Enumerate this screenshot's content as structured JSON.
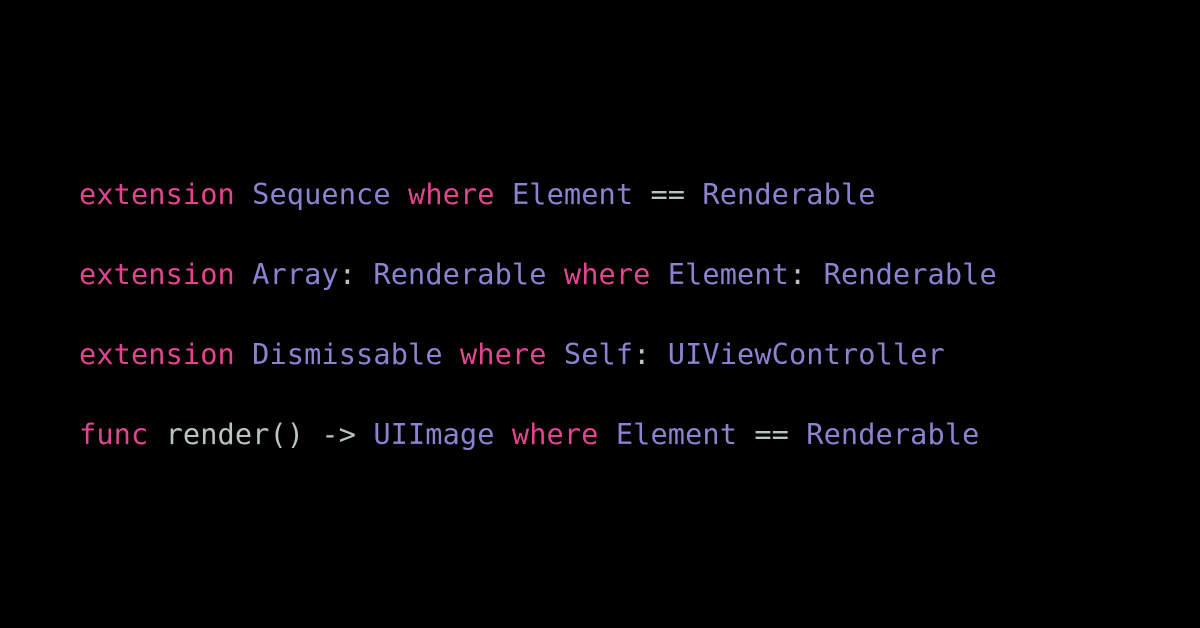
{
  "colors": {
    "background": "#000000",
    "keyword": "#e0458e",
    "type": "#8a83cf",
    "plain": "#b8c4c1"
  },
  "code_lines": [
    {
      "tokens": [
        {
          "text": "extension",
          "kind": "keyword"
        },
        {
          "text": " ",
          "kind": "plain"
        },
        {
          "text": "Sequence",
          "kind": "type"
        },
        {
          "text": " ",
          "kind": "plain"
        },
        {
          "text": "where",
          "kind": "keyword"
        },
        {
          "text": " ",
          "kind": "plain"
        },
        {
          "text": "Element",
          "kind": "type"
        },
        {
          "text": " == ",
          "kind": "punct"
        },
        {
          "text": "Renderable",
          "kind": "type"
        }
      ]
    },
    {
      "tokens": [
        {
          "text": "extension",
          "kind": "keyword"
        },
        {
          "text": " ",
          "kind": "plain"
        },
        {
          "text": "Array",
          "kind": "type"
        },
        {
          "text": ": ",
          "kind": "punct"
        },
        {
          "text": "Renderable",
          "kind": "type"
        },
        {
          "text": " ",
          "kind": "plain"
        },
        {
          "text": "where",
          "kind": "keyword"
        },
        {
          "text": " ",
          "kind": "plain"
        },
        {
          "text": "Element",
          "kind": "type"
        },
        {
          "text": ": ",
          "kind": "punct"
        },
        {
          "text": "Renderable",
          "kind": "type"
        }
      ]
    },
    {
      "tokens": [
        {
          "text": "extension",
          "kind": "keyword"
        },
        {
          "text": " ",
          "kind": "plain"
        },
        {
          "text": "Dismissable",
          "kind": "type"
        },
        {
          "text": " ",
          "kind": "plain"
        },
        {
          "text": "where",
          "kind": "keyword"
        },
        {
          "text": " ",
          "kind": "plain"
        },
        {
          "text": "Self",
          "kind": "type"
        },
        {
          "text": ": ",
          "kind": "punct"
        },
        {
          "text": "UIViewController",
          "kind": "type"
        }
      ]
    },
    {
      "tokens": [
        {
          "text": "func",
          "kind": "keyword"
        },
        {
          "text": " render() -> ",
          "kind": "plain"
        },
        {
          "text": "UIImage",
          "kind": "type"
        },
        {
          "text": " ",
          "kind": "plain"
        },
        {
          "text": "where",
          "kind": "keyword"
        },
        {
          "text": " ",
          "kind": "plain"
        },
        {
          "text": "Element",
          "kind": "type"
        },
        {
          "text": " == ",
          "kind": "punct"
        },
        {
          "text": "Renderable",
          "kind": "type"
        }
      ]
    }
  ]
}
